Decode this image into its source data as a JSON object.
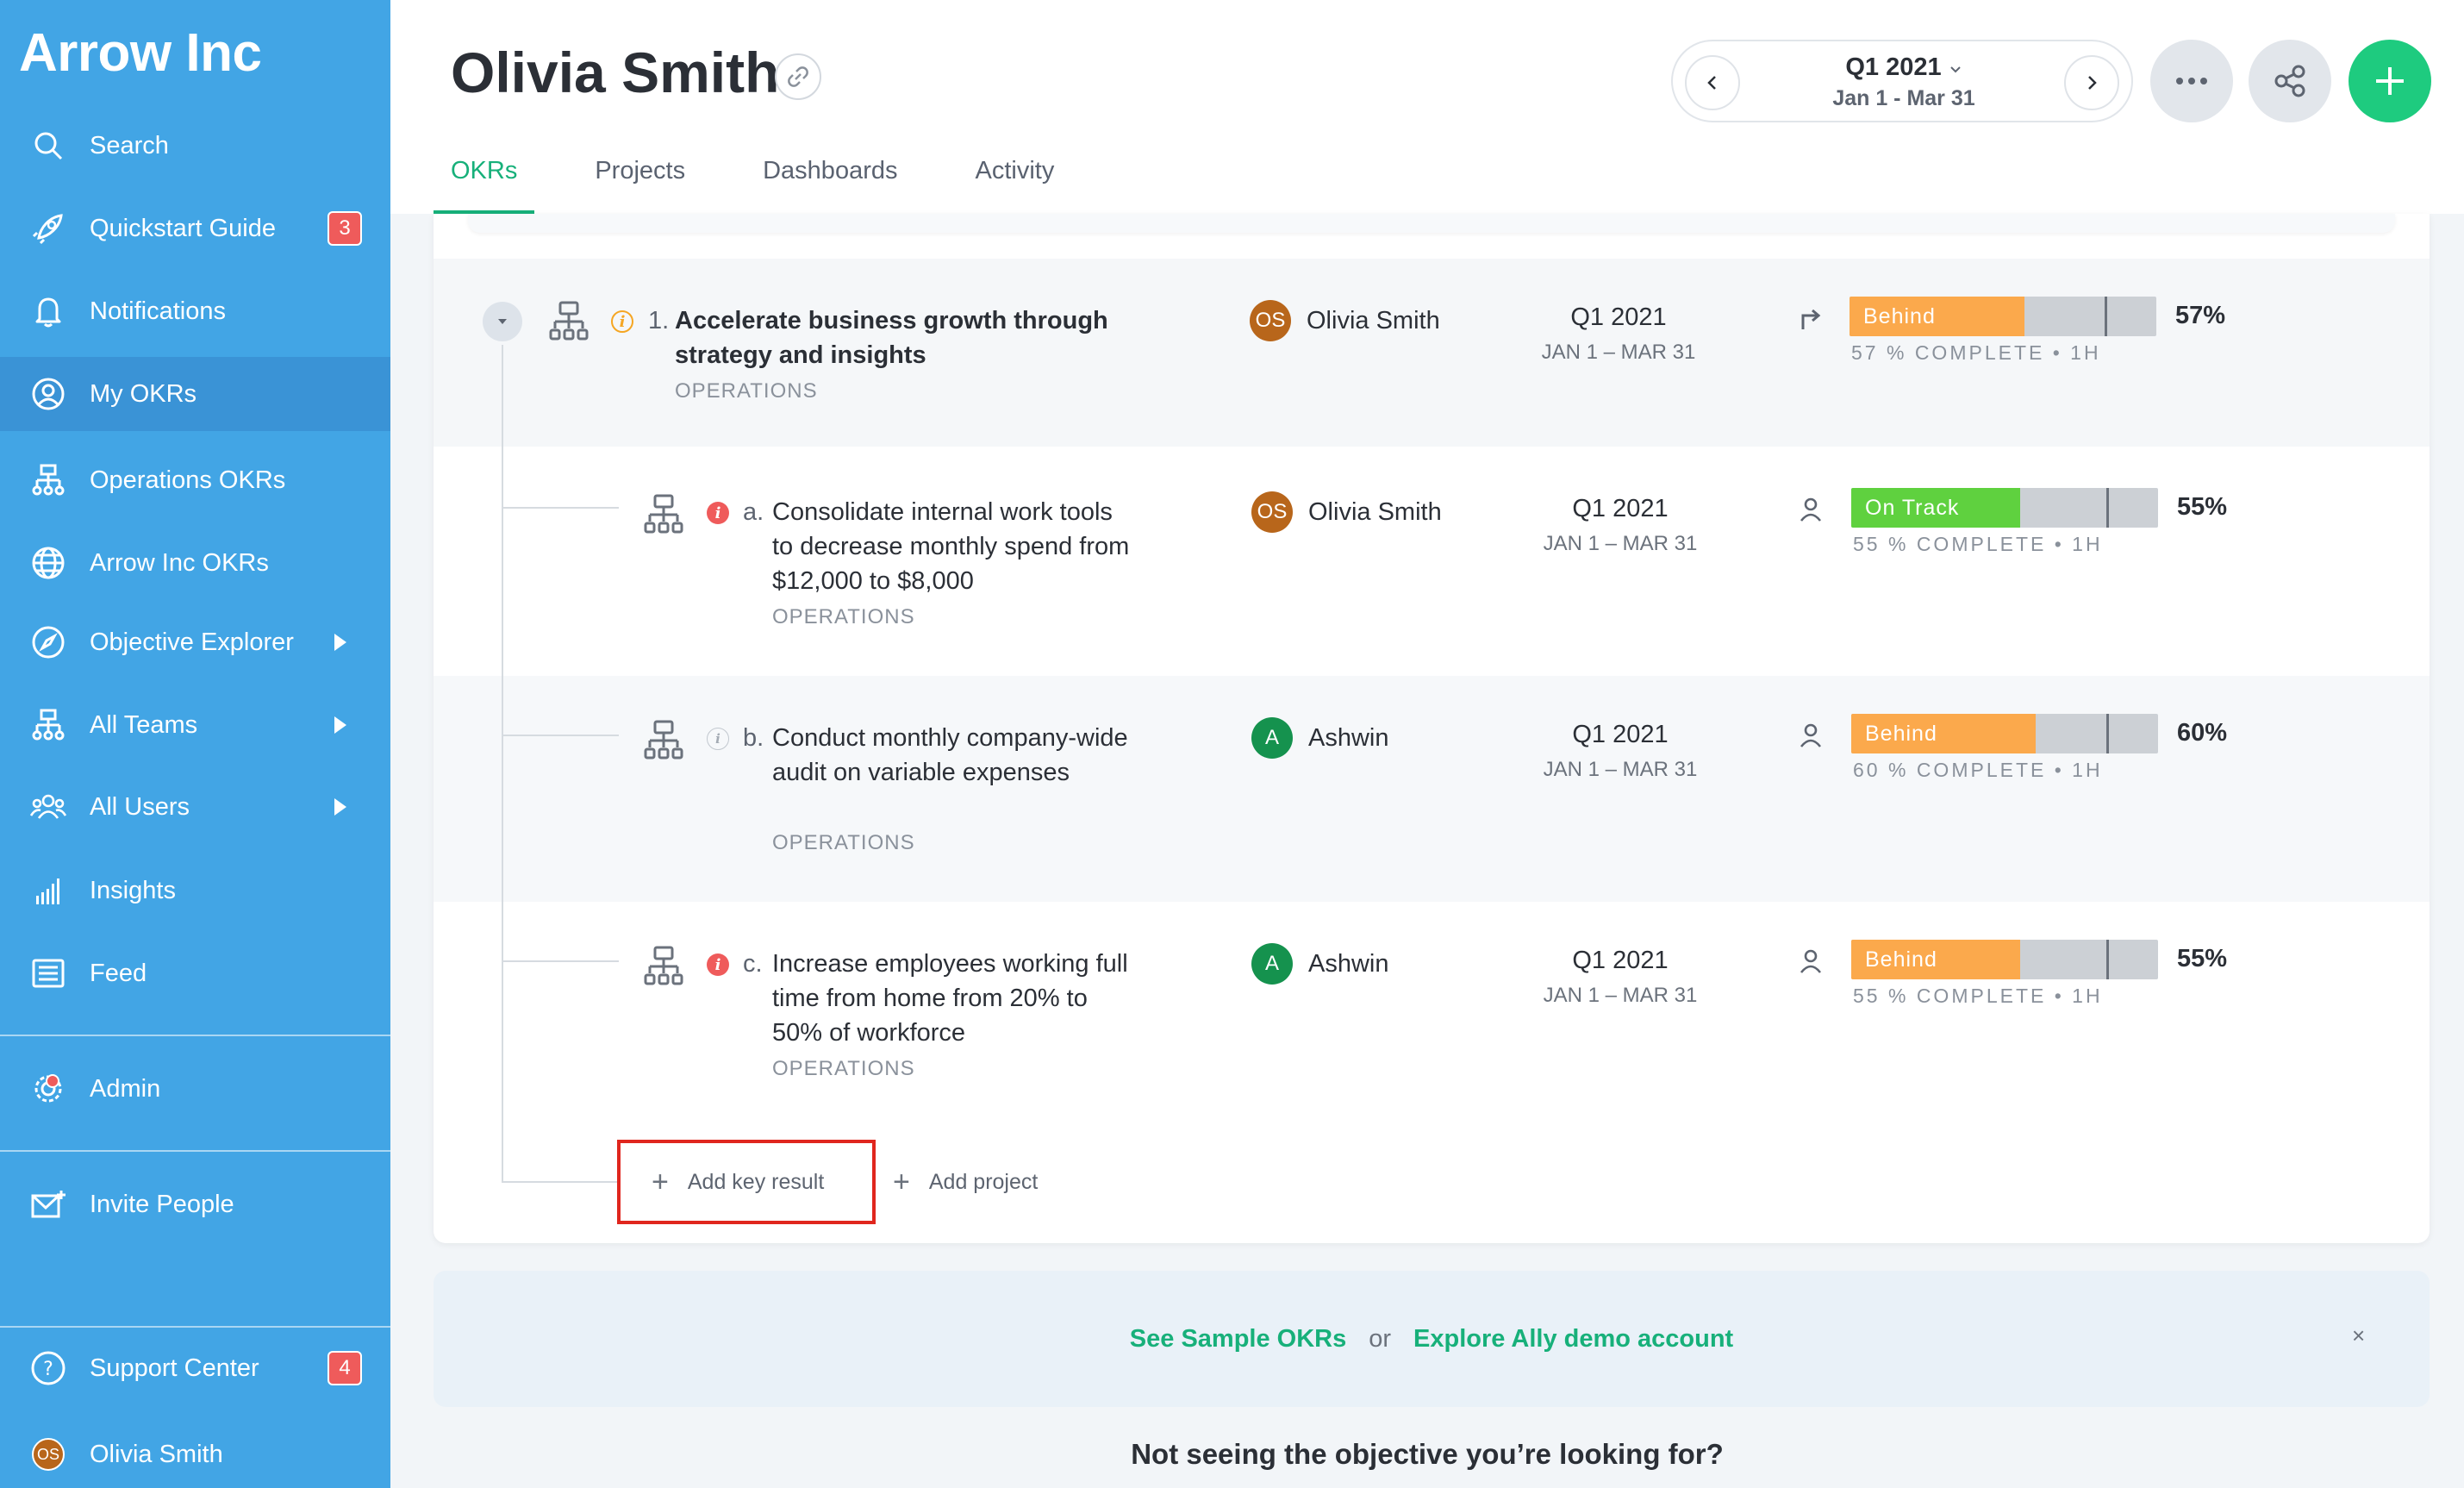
{
  "sidebar": {
    "brand": "Arrow Inc",
    "items": [
      {
        "label": "Search",
        "icon": "search-icon"
      },
      {
        "label": "Quickstart Guide",
        "icon": "rocket-icon",
        "badge": "3"
      },
      {
        "label": "Notifications",
        "icon": "bell-icon"
      },
      {
        "label": "My OKRs",
        "icon": "user-circle-icon",
        "active": true
      },
      {
        "label": "Operations OKRs",
        "icon": "org-chart-icon"
      },
      {
        "label": "Arrow Inc OKRs",
        "icon": "globe-icon"
      },
      {
        "label": "Objective Explorer",
        "icon": "compass-icon"
      },
      {
        "label": "All Teams",
        "icon": "org-chart-icon"
      },
      {
        "label": "All Users",
        "icon": "users-icon"
      },
      {
        "label": "Insights",
        "icon": "bar-chart-icon"
      },
      {
        "label": "Feed",
        "icon": "feed-icon"
      },
      {
        "label": "Admin",
        "icon": "gear-icon"
      },
      {
        "label": "Invite People",
        "icon": "invite-mail-icon"
      },
      {
        "label": "Support Center",
        "icon": "help-icon",
        "badge": "4"
      },
      {
        "label": "Olivia Smith",
        "avatar": "OS"
      }
    ]
  },
  "header": {
    "title": "Olivia Smith",
    "period": {
      "label": "Q1 2021",
      "range": "Jan 1 - Mar 31"
    },
    "tabs": [
      "OKRs",
      "Projects",
      "Dashboards",
      "Activity"
    ]
  },
  "objective": {
    "number": "1.",
    "title": "Accelerate business growth through strategy and insights",
    "team": "OPERATIONS",
    "owner": {
      "initials": "OS",
      "name": "Olivia Smith"
    },
    "period": {
      "label": "Q1 2021",
      "range": "JAN 1 – MAR 31"
    },
    "status": "Behind",
    "progress": 0.57,
    "progress_label": "57 % COMPLETE • 1H",
    "percent": "57%"
  },
  "key_results": [
    {
      "number": "a.",
      "title": "Consolidate internal work tools to decrease monthly spend from $12,000 to $8,000",
      "team": "OPERATIONS",
      "owner": {
        "initials": "OS",
        "name": "Olivia Smith"
      },
      "period": {
        "label": "Q1 2021",
        "range": "JAN 1 – MAR 31"
      },
      "status": "On Track",
      "progress": 0.55,
      "progress_label": "55 % COMPLETE • 1H",
      "percent": "55%"
    },
    {
      "number": "b.",
      "title": "Conduct monthly company-wide audit on variable expenses",
      "team": "OPERATIONS",
      "owner": {
        "initials": "A",
        "name": "Ashwin"
      },
      "period": {
        "label": "Q1 2021",
        "range": "JAN 1 – MAR 31"
      },
      "status": "Behind",
      "progress": 0.6,
      "progress_label": "60 % COMPLETE • 1H",
      "percent": "60%"
    },
    {
      "number": "c.",
      "title": "Increase employees working full time from home from 20% to 50% of workforce",
      "team": "OPERATIONS",
      "owner": {
        "initials": "A",
        "name": "Ashwin"
      },
      "period": {
        "label": "Q1 2021",
        "range": "JAN 1 – MAR 31"
      },
      "status": "Behind",
      "progress": 0.55,
      "progress_label": "55 % COMPLETE • 1H",
      "percent": "55%"
    }
  ],
  "actions": {
    "add_key_result": "Add key result",
    "add_project": "Add project"
  },
  "banner": {
    "link1": "See Sample OKRs",
    "or": "or",
    "link2": "Explore Ally demo account",
    "close": "×"
  },
  "footer_question": "Not seeing the objective you’re looking for?",
  "colors": {
    "behind": "#fba94c",
    "on_track": "#5fd13f",
    "accent": "#17b07a",
    "sidebar": "#42a5e5"
  }
}
